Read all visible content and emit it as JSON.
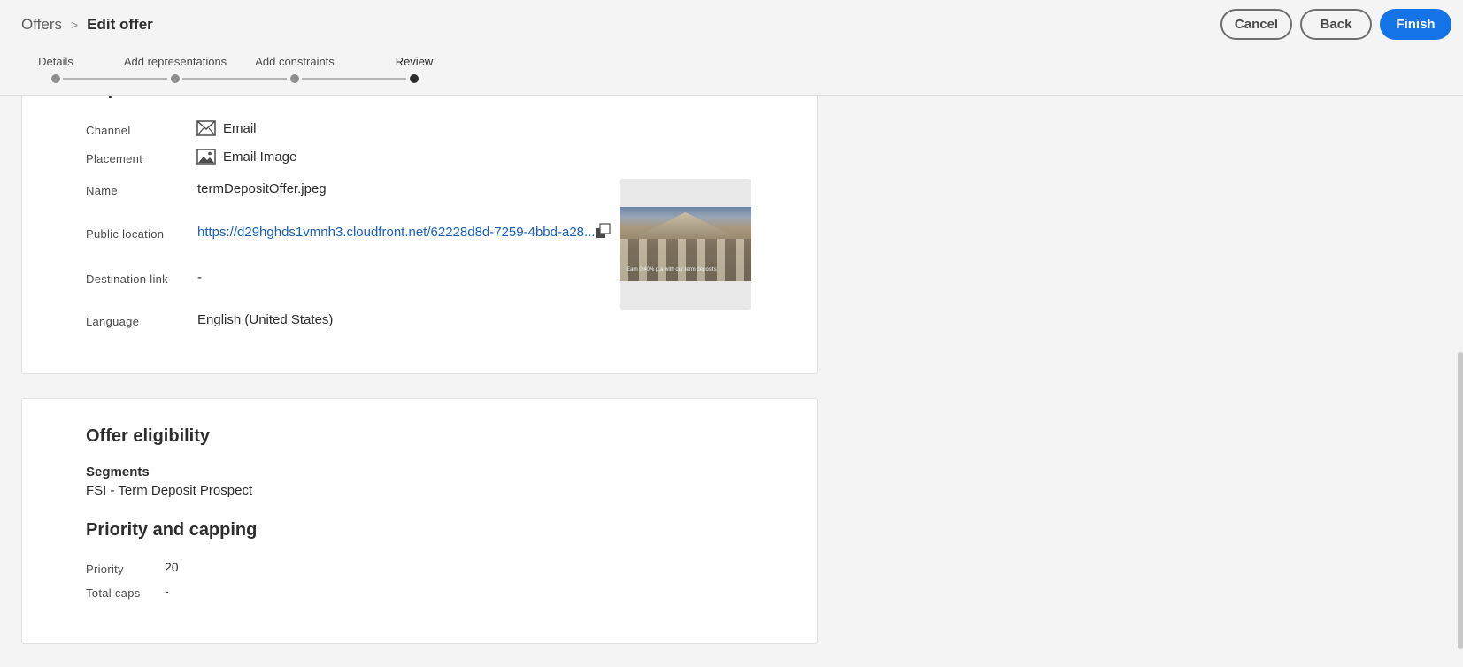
{
  "header": {
    "breadcrumb_root": "Offers",
    "breadcrumb_separator": ">",
    "breadcrumb_current": "Edit offer",
    "cancel_label": "Cancel",
    "back_label": "Back",
    "finish_label": "Finish"
  },
  "stepper": {
    "steps": [
      {
        "label": "Details",
        "active": false
      },
      {
        "label": "Add representations",
        "active": false
      },
      {
        "label": "Add constraints",
        "active": false
      },
      {
        "label": "Review",
        "active": true
      }
    ]
  },
  "representations": {
    "title": "Representations",
    "channel_label": "Channel",
    "channel_value": "Email",
    "channel_icon": "envelope-icon",
    "placement_label": "Placement",
    "placement_value": "Email Image",
    "placement_icon": "image-icon",
    "name_label": "Name",
    "name_value": "termDepositOffer.jpeg",
    "public_location_label": "Public location",
    "public_location_value": "https://d29hghds1vmnh3.cloudfront.net/62228d8d-7259-4bbd-a28...",
    "destination_link_label": "Destination link",
    "destination_link_value": "-",
    "language_label": "Language",
    "language_value": "English (United States)",
    "preview_caption": "Earn 0.40% p.a with our term deposits"
  },
  "eligibility": {
    "title": "Offer eligibility",
    "segments_label": "Segments",
    "segments_value": "FSI - Term Deposit Prospect",
    "priority_title": "Priority and capping",
    "priority_label": "Priority",
    "priority_value": "20",
    "total_caps_label": "Total caps",
    "total_caps_value": "-"
  },
  "colors": {
    "accent": "#1473e6",
    "link": "#1a5fbf",
    "background": "#f4f4f4"
  }
}
